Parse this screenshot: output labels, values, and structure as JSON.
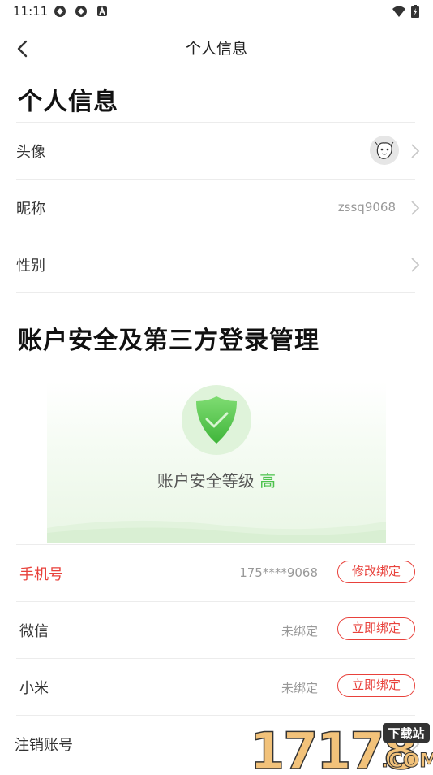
{
  "status_bar": {
    "time": "11:11"
  },
  "nav": {
    "title": "个人信息"
  },
  "personal_info": {
    "title": "个人信息",
    "rows": [
      {
        "label": "头像",
        "value": ""
      },
      {
        "label": "昵称",
        "value": "zssq9068"
      },
      {
        "label": "性别",
        "value": ""
      }
    ]
  },
  "security": {
    "title": "账户安全及第三方登录管理",
    "level_text": "账户安全等级",
    "level_value": "高",
    "accent_color": "#4cc24c"
  },
  "bindings": [
    {
      "label": "手机号",
      "value": "175****9068",
      "button": "修改绑定",
      "highlight": true
    },
    {
      "label": "微信",
      "value": "未绑定",
      "button": "立即绑定"
    },
    {
      "label": "小米",
      "value": "未绑定",
      "button": "立即绑定"
    }
  ],
  "deregister": {
    "label": "注销账号"
  },
  "watermark": {
    "text": "17178",
    "badge": "下载站",
    "domain": ".COM"
  },
  "colors": {
    "accent_red": "#e8413b",
    "security_green": "#4cc24c"
  }
}
